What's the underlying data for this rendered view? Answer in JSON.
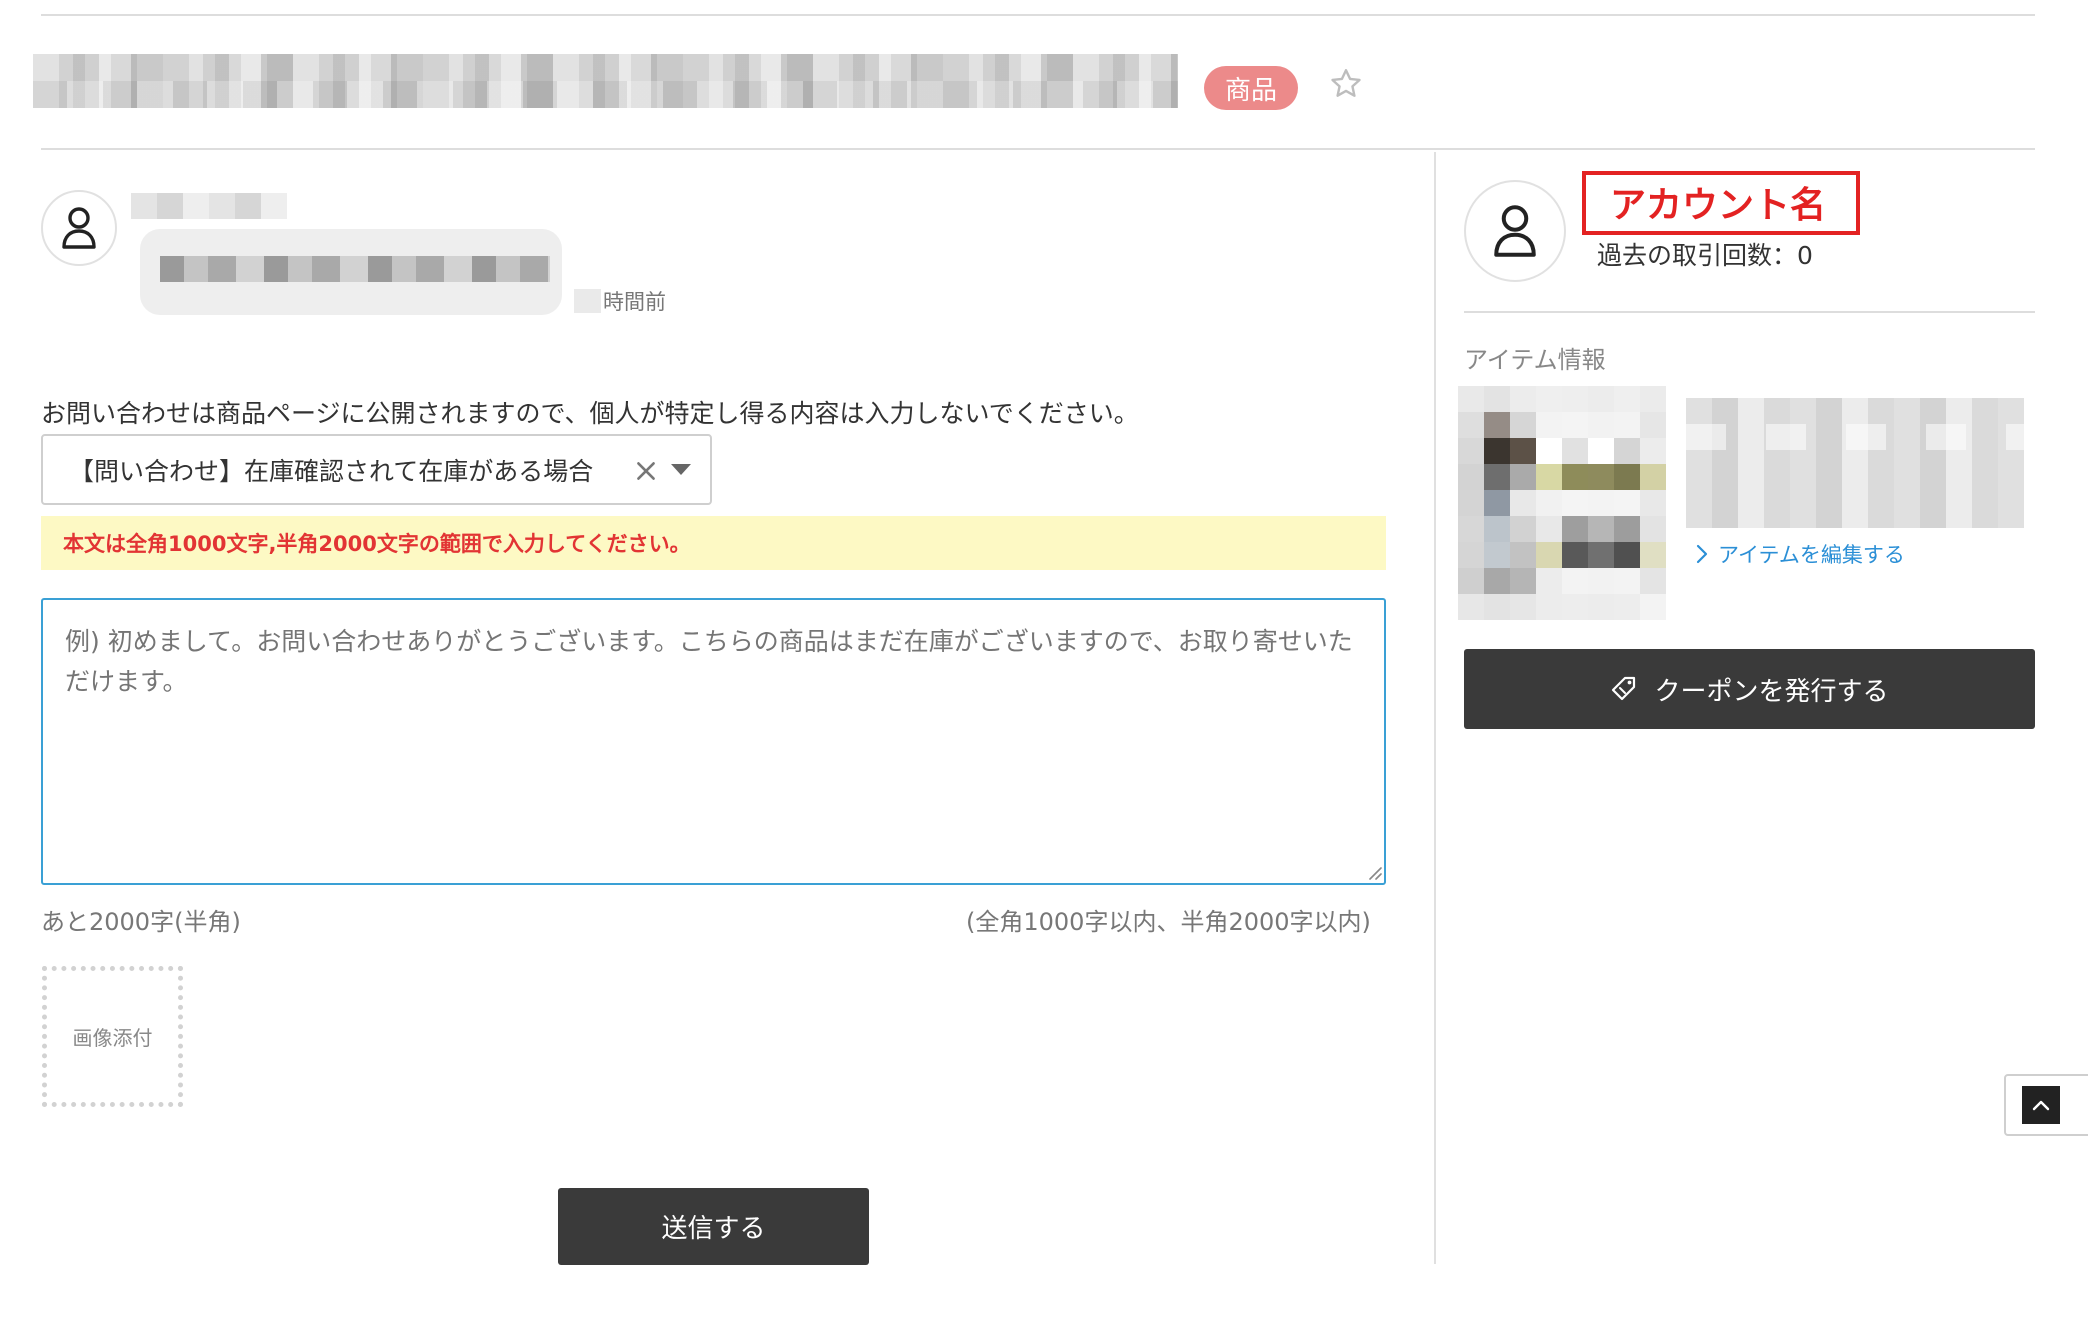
{
  "header": {
    "product_badge": "商品",
    "star_icon": "star-outline-icon"
  },
  "message": {
    "time_suffix": "時間前"
  },
  "form": {
    "notice": "お問い合わせは商品ページに公開されますので、個人が特定し得る内容は入力しないでください。",
    "template_select": {
      "selected": "【問い合わせ】在庫確認されて在庫がある場合"
    },
    "warning": "本文は全角1000文字,半角2000文字の範囲で入力してください。",
    "body_placeholder": "例) 初めまして。お問い合わせありがとうございます。こちらの商品はまだ在庫がございますので、お取り寄せいただけます。",
    "remaining": "あと2000字(半角)",
    "limit_note": "(全角1000字以内、半角2000字以内)",
    "attach_label": "画像添付",
    "send_label": "送信する"
  },
  "account": {
    "name": "アカウント名",
    "trade_count": "過去の取引回数：0"
  },
  "item": {
    "section_label": "アイテム情報",
    "edit_link": "アイテムを編集する"
  },
  "coupon": {
    "label": "クーポンを発行する"
  },
  "colors": {
    "badge": "#ec8a8a",
    "warning_bg": "#fdf9c4",
    "warning_text": "#e23434",
    "highlight_box": "#e32222",
    "link": "#2b8fd6",
    "dark_button": "#3a3a3a",
    "input_focus": "#3aa0d5"
  }
}
